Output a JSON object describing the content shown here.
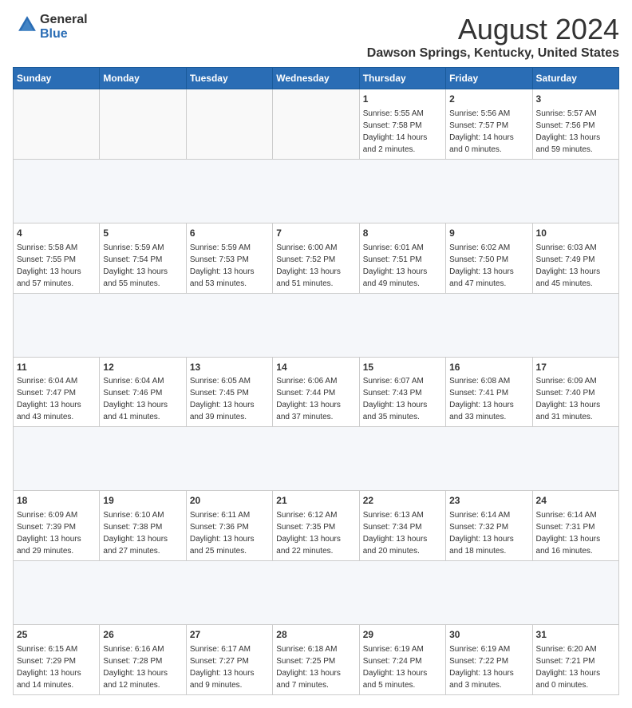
{
  "header": {
    "logo_line1": "General",
    "logo_line2": "Blue",
    "main_title": "August 2024",
    "sub_title": "Dawson Springs, Kentucky, United States"
  },
  "calendar": {
    "days_of_week": [
      "Sunday",
      "Monday",
      "Tuesday",
      "Wednesday",
      "Thursday",
      "Friday",
      "Saturday"
    ],
    "weeks": [
      {
        "days": [
          {
            "num": "",
            "info": ""
          },
          {
            "num": "",
            "info": ""
          },
          {
            "num": "",
            "info": ""
          },
          {
            "num": "",
            "info": ""
          },
          {
            "num": "1",
            "info": "Sunrise: 5:55 AM\nSunset: 7:58 PM\nDaylight: 14 hours\nand 2 minutes."
          },
          {
            "num": "2",
            "info": "Sunrise: 5:56 AM\nSunset: 7:57 PM\nDaylight: 14 hours\nand 0 minutes."
          },
          {
            "num": "3",
            "info": "Sunrise: 5:57 AM\nSunset: 7:56 PM\nDaylight: 13 hours\nand 59 minutes."
          }
        ]
      },
      {
        "days": [
          {
            "num": "4",
            "info": "Sunrise: 5:58 AM\nSunset: 7:55 PM\nDaylight: 13 hours\nand 57 minutes."
          },
          {
            "num": "5",
            "info": "Sunrise: 5:59 AM\nSunset: 7:54 PM\nDaylight: 13 hours\nand 55 minutes."
          },
          {
            "num": "6",
            "info": "Sunrise: 5:59 AM\nSunset: 7:53 PM\nDaylight: 13 hours\nand 53 minutes."
          },
          {
            "num": "7",
            "info": "Sunrise: 6:00 AM\nSunset: 7:52 PM\nDaylight: 13 hours\nand 51 minutes."
          },
          {
            "num": "8",
            "info": "Sunrise: 6:01 AM\nSunset: 7:51 PM\nDaylight: 13 hours\nand 49 minutes."
          },
          {
            "num": "9",
            "info": "Sunrise: 6:02 AM\nSunset: 7:50 PM\nDaylight: 13 hours\nand 47 minutes."
          },
          {
            "num": "10",
            "info": "Sunrise: 6:03 AM\nSunset: 7:49 PM\nDaylight: 13 hours\nand 45 minutes."
          }
        ]
      },
      {
        "days": [
          {
            "num": "11",
            "info": "Sunrise: 6:04 AM\nSunset: 7:47 PM\nDaylight: 13 hours\nand 43 minutes."
          },
          {
            "num": "12",
            "info": "Sunrise: 6:04 AM\nSunset: 7:46 PM\nDaylight: 13 hours\nand 41 minutes."
          },
          {
            "num": "13",
            "info": "Sunrise: 6:05 AM\nSunset: 7:45 PM\nDaylight: 13 hours\nand 39 minutes."
          },
          {
            "num": "14",
            "info": "Sunrise: 6:06 AM\nSunset: 7:44 PM\nDaylight: 13 hours\nand 37 minutes."
          },
          {
            "num": "15",
            "info": "Sunrise: 6:07 AM\nSunset: 7:43 PM\nDaylight: 13 hours\nand 35 minutes."
          },
          {
            "num": "16",
            "info": "Sunrise: 6:08 AM\nSunset: 7:41 PM\nDaylight: 13 hours\nand 33 minutes."
          },
          {
            "num": "17",
            "info": "Sunrise: 6:09 AM\nSunset: 7:40 PM\nDaylight: 13 hours\nand 31 minutes."
          }
        ]
      },
      {
        "days": [
          {
            "num": "18",
            "info": "Sunrise: 6:09 AM\nSunset: 7:39 PM\nDaylight: 13 hours\nand 29 minutes."
          },
          {
            "num": "19",
            "info": "Sunrise: 6:10 AM\nSunset: 7:38 PM\nDaylight: 13 hours\nand 27 minutes."
          },
          {
            "num": "20",
            "info": "Sunrise: 6:11 AM\nSunset: 7:36 PM\nDaylight: 13 hours\nand 25 minutes."
          },
          {
            "num": "21",
            "info": "Sunrise: 6:12 AM\nSunset: 7:35 PM\nDaylight: 13 hours\nand 22 minutes."
          },
          {
            "num": "22",
            "info": "Sunrise: 6:13 AM\nSunset: 7:34 PM\nDaylight: 13 hours\nand 20 minutes."
          },
          {
            "num": "23",
            "info": "Sunrise: 6:14 AM\nSunset: 7:32 PM\nDaylight: 13 hours\nand 18 minutes."
          },
          {
            "num": "24",
            "info": "Sunrise: 6:14 AM\nSunset: 7:31 PM\nDaylight: 13 hours\nand 16 minutes."
          }
        ]
      },
      {
        "days": [
          {
            "num": "25",
            "info": "Sunrise: 6:15 AM\nSunset: 7:29 PM\nDaylight: 13 hours\nand 14 minutes."
          },
          {
            "num": "26",
            "info": "Sunrise: 6:16 AM\nSunset: 7:28 PM\nDaylight: 13 hours\nand 12 minutes."
          },
          {
            "num": "27",
            "info": "Sunrise: 6:17 AM\nSunset: 7:27 PM\nDaylight: 13 hours\nand 9 minutes."
          },
          {
            "num": "28",
            "info": "Sunrise: 6:18 AM\nSunset: 7:25 PM\nDaylight: 13 hours\nand 7 minutes."
          },
          {
            "num": "29",
            "info": "Sunrise: 6:19 AM\nSunset: 7:24 PM\nDaylight: 13 hours\nand 5 minutes."
          },
          {
            "num": "30",
            "info": "Sunrise: 6:19 AM\nSunset: 7:22 PM\nDaylight: 13 hours\nand 3 minutes."
          },
          {
            "num": "31",
            "info": "Sunrise: 6:20 AM\nSunset: 7:21 PM\nDaylight: 13 hours\nand 0 minutes."
          }
        ]
      }
    ]
  }
}
